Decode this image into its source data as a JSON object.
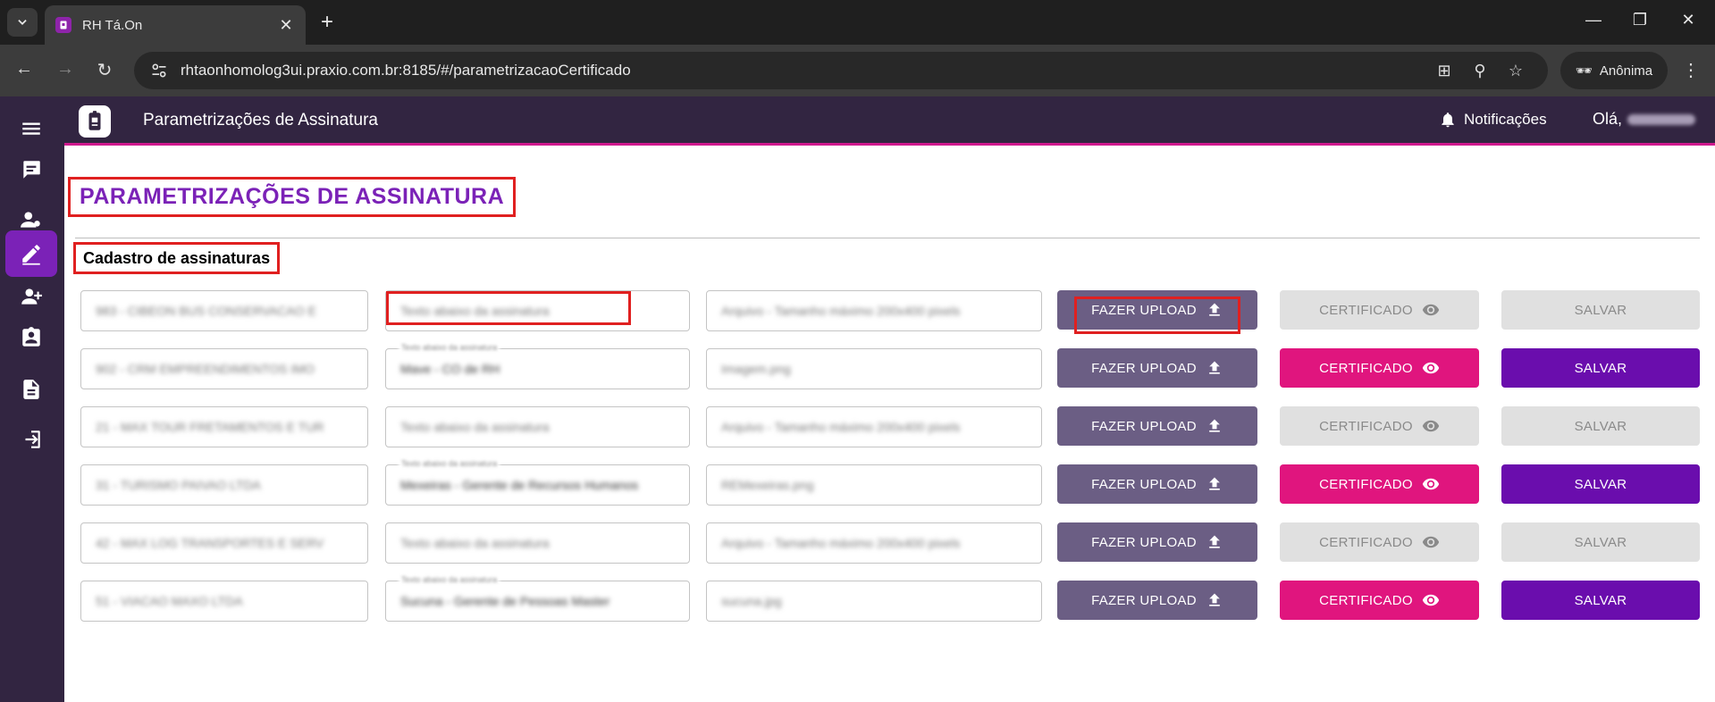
{
  "browser": {
    "tab_title": "RH Tá.On",
    "url": "rhtaonhomolog3ui.praxio.com.br:8185/#/parametrizacaoCertificado",
    "incognito_label": "Anônima"
  },
  "app": {
    "header_title": "Parametrizações de Assinatura",
    "notifications_label": "Notificações",
    "greeting": "Olá,"
  },
  "page": {
    "heading": "PARAMETRIZAÇÕES DE ASSINATURA",
    "section_title": "Cadastro de assinaturas"
  },
  "labels": {
    "upload": "FAZER UPLOAD",
    "certificate": "CERTIFICADO",
    "save": "SALVAR"
  },
  "rows": [
    {
      "company": "983 - CIBEON BUS CONSERVACAO E",
      "signature_text": "Texto abaixo da assinatura",
      "signature_legend": "",
      "file": "Arquivo - Tamanho máximo 200x400 pixels",
      "enabled": false
    },
    {
      "company": "902 - CRM EMPREENDIMENTOS IMO",
      "signature_text": "Mave - CO de RH",
      "signature_legend": "Texto abaixo da assinatura",
      "file": "Imagem.png",
      "enabled": true
    },
    {
      "company": "21 - MAX TOUR FRETAMENTOS E TUR",
      "signature_text": "Texto abaixo da assinatura",
      "signature_legend": "",
      "file": "Arquivo - Tamanho máximo 200x400 pixels",
      "enabled": false
    },
    {
      "company": "31 - TURISMO PAIVAO LTDA",
      "signature_text": "Mexeiras - Gerente de Recursos Humanos",
      "signature_legend": "Texto abaixo da assinatura",
      "file": "REMexeiras.png",
      "enabled": true
    },
    {
      "company": "42 - MAX LOG TRANSPORTES E SERV",
      "signature_text": "Texto abaixo da assinatura",
      "signature_legend": "",
      "file": "Arquivo - Tamanho máximo 200x400 pixels",
      "enabled": false
    },
    {
      "company": "51 - VIACAO MAXO LTDA",
      "signature_text": "Sucuna - Gerente de Pessoas Master",
      "signature_legend": "Texto abaixo da assinatura",
      "file": "sucuna.jpg",
      "enabled": true
    }
  ]
}
